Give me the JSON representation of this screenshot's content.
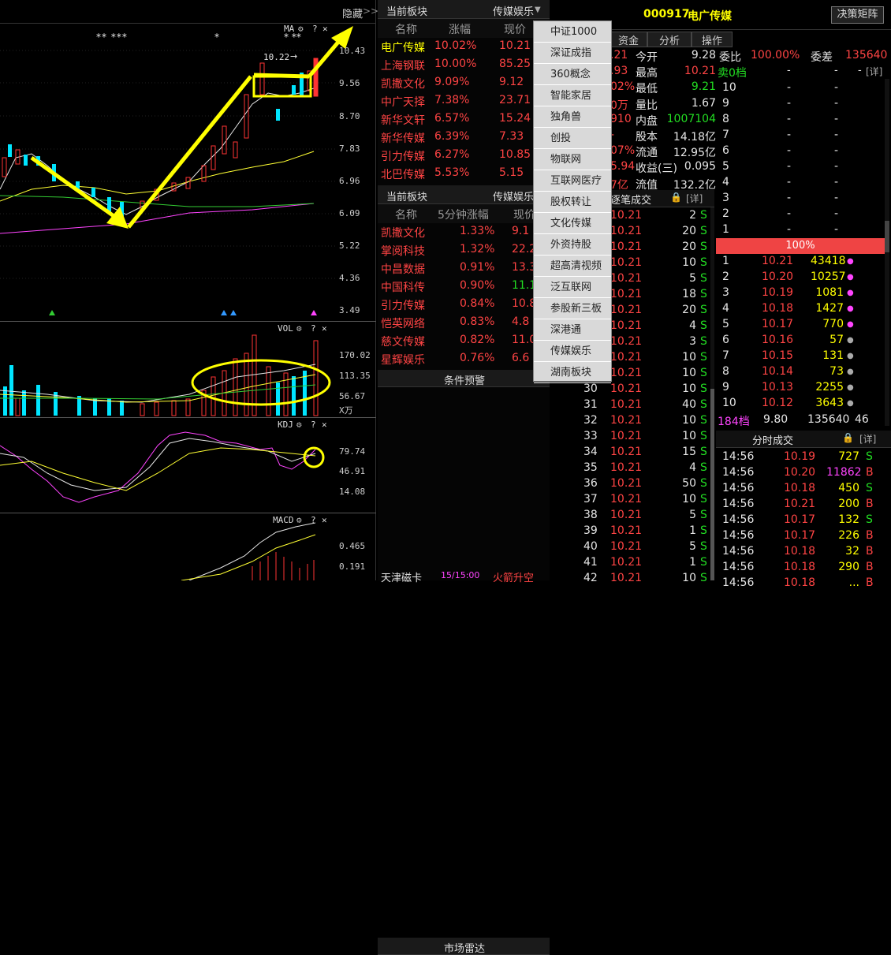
{
  "chart": {
    "header_label": "隐藏",
    "header_chevron": ">>",
    "ma_title": "MA",
    "vol_title": "VOL",
    "kdj_title": "KDJ",
    "macd_title": "MACD",
    "price_axis": [
      "10.43",
      "9.56",
      "8.70",
      "7.83",
      "6.96",
      "6.09",
      "5.22",
      "4.36",
      "3.49"
    ],
    "vol_axis": [
      "170.02",
      "113.35",
      "56.67",
      "X万"
    ],
    "kdj_axis": [
      "79.74",
      "46.91",
      "14.08"
    ],
    "macd_axis": [
      "0.465",
      "0.191"
    ],
    "high_label": "10.22",
    "stars": [
      "** ***",
      "*",
      "* **"
    ]
  },
  "plates1": {
    "title": "当前板块",
    "selector": "传媒娱乐",
    "cols": [
      "名称",
      "涨幅",
      "现价"
    ],
    "rows": [
      {
        "name": "电广传媒",
        "chg": "10.02%",
        "price": "10.21"
      },
      {
        "name": "上海钢联",
        "chg": "10.00%",
        "price": "85.25"
      },
      {
        "name": "凯撒文化",
        "chg": "9.09%",
        "price": "9.12"
      },
      {
        "name": "中广天择",
        "chg": "7.38%",
        "price": "23.71"
      },
      {
        "name": "新华文轩",
        "chg": "6.57%",
        "price": "15.24"
      },
      {
        "name": "新华传媒",
        "chg": "6.39%",
        "price": "7.33"
      },
      {
        "name": "引力传媒",
        "chg": "6.27%",
        "price": "10.85"
      },
      {
        "name": "北巴传媒",
        "chg": "5.53%",
        "price": "5.15"
      }
    ]
  },
  "plates2": {
    "title": "当前板块",
    "selector": "传媒娱乐",
    "cols": [
      "名称",
      "5分钟涨幅",
      "现价"
    ],
    "rows": [
      {
        "name": "凯撒文化",
        "chg": "1.33%",
        "price": "9.1"
      },
      {
        "name": "掌阅科技",
        "chg": "1.32%",
        "price": "22.2"
      },
      {
        "name": "中昌数据",
        "chg": "0.91%",
        "price": "13.3"
      },
      {
        "name": "中国科传",
        "chg": "0.90%",
        "price": "11.1"
      },
      {
        "name": "引力传媒",
        "chg": "0.84%",
        "price": "10.8"
      },
      {
        "name": "恺英网络",
        "chg": "0.83%",
        "price": "4.8"
      },
      {
        "name": "慈文传媒",
        "chg": "0.82%",
        "price": "11.0"
      },
      {
        "name": "星辉娱乐",
        "chg": "0.76%",
        "price": "6.6"
      }
    ]
  },
  "alerts": {
    "title": "条件预警"
  },
  "radar": {
    "title": "市场雷达",
    "row": {
      "name": "天津磁卡",
      "time": "15/15:00",
      "event": "火箭升空"
    }
  },
  "dropdown": [
    "中证1000",
    "深证成指",
    "360概念",
    "智能家居",
    "独角兽",
    "创投",
    "物联网",
    "互联网医疗",
    "股权转让",
    "文化传媒",
    "外资持股",
    "超高清视频",
    "泛互联网",
    "参股新三板",
    "深港通",
    "传媒娱乐",
    "湖南板块"
  ],
  "stock": {
    "code": "000917",
    "name": "电广传媒",
    "decision_btn": "决策矩阵",
    "tabs": [
      "资金",
      "分析",
      "操作"
    ],
    "quote": [
      {
        "v1": ".21",
        "l": "今开",
        "v2": "9.28"
      },
      {
        "v1": ".93",
        "l": "最高",
        "v2": "10.21"
      },
      {
        "v1": "02%",
        "l": "最低",
        "v2": "9.21"
      },
      {
        "v1": "0万",
        "l": "量比",
        "v2": "1.67"
      },
      {
        "v1": "910",
        "l": "内盘",
        "v2": "1007104"
      },
      {
        "v1": "-",
        "l": "股本",
        "v2": "14.18亿"
      },
      {
        "v1": "07%",
        "l": "流通",
        "v2": "12.95亿"
      },
      {
        "v1": "5.94",
        "l": "收益(三)",
        "v2": "0.095"
      },
      {
        "v1": "7亿",
        "l": "流值",
        "v2": "132.2亿"
      }
    ],
    "weibi_label": "委比",
    "weibi": "100.00%",
    "weicha_label": "委差",
    "weicha": "135640",
    "sell0": "卖0档",
    "detail": "[详]",
    "sell_levels": [
      "10",
      "9",
      "8",
      "7",
      "6",
      "5",
      "4",
      "3",
      "2",
      "1"
    ],
    "pct_bar": "100%",
    "buy_levels": [
      {
        "lv": "1",
        "p": "10.21",
        "v": "43418"
      },
      {
        "lv": "2",
        "p": "10.20",
        "v": "10257"
      },
      {
        "lv": "3",
        "p": "10.19",
        "v": "1081"
      },
      {
        "lv": "4",
        "p": "10.18",
        "v": "1427"
      },
      {
        "lv": "5",
        "p": "10.17",
        "v": "770"
      },
      {
        "lv": "6",
        "p": "10.16",
        "v": "57"
      },
      {
        "lv": "7",
        "p": "10.15",
        "v": "131"
      },
      {
        "lv": "8",
        "p": "10.14",
        "v": "73"
      },
      {
        "lv": "9",
        "p": "10.13",
        "v": "2255"
      },
      {
        "lv": "10",
        "p": "10.12",
        "v": "3643"
      }
    ],
    "buy_summary": {
      "a": "184档",
      "b": "9.80",
      "c": "135640",
      "d": "46"
    },
    "ticks_title": "逐笔成交",
    "ticks": [
      {
        "n": "",
        "p": "10.21",
        "v": "2",
        "s": "S"
      },
      {
        "n": "",
        "p": "10.21",
        "v": "20",
        "s": "S"
      },
      {
        "n": "",
        "p": "10.21",
        "v": "20",
        "s": "S"
      },
      {
        "n": "",
        "p": "10.21",
        "v": "10",
        "s": "S"
      },
      {
        "n": "",
        "p": "10.21",
        "v": "5",
        "s": "S"
      },
      {
        "n": "",
        "p": "10.21",
        "v": "18",
        "s": "S"
      },
      {
        "n": "",
        "p": "10.21",
        "v": "20",
        "s": "S"
      },
      {
        "n": "",
        "p": "10.21",
        "v": "4",
        "s": "S"
      },
      {
        "n": "",
        "p": "10.21",
        "v": "3",
        "s": "S"
      },
      {
        "n": "",
        "p": "10.21",
        "v": "10",
        "s": "S"
      },
      {
        "n": "",
        "p": "10.21",
        "v": "10",
        "s": "S"
      },
      {
        "n": "30",
        "p": "10.21",
        "v": "10",
        "s": "S"
      },
      {
        "n": "31",
        "p": "10.21",
        "v": "40",
        "s": "S"
      },
      {
        "n": "32",
        "p": "10.21",
        "v": "10",
        "s": "S"
      },
      {
        "n": "33",
        "p": "10.21",
        "v": "10",
        "s": "S"
      },
      {
        "n": "34",
        "p": "10.21",
        "v": "15",
        "s": "S"
      },
      {
        "n": "35",
        "p": "10.21",
        "v": "4",
        "s": "S"
      },
      {
        "n": "36",
        "p": "10.21",
        "v": "50",
        "s": "S"
      },
      {
        "n": "37",
        "p": "10.21",
        "v": "10",
        "s": "S"
      },
      {
        "n": "38",
        "p": "10.21",
        "v": "5",
        "s": "S"
      },
      {
        "n": "39",
        "p": "10.21",
        "v": "1",
        "s": "S"
      },
      {
        "n": "40",
        "p": "10.21",
        "v": "5",
        "s": "S"
      },
      {
        "n": "41",
        "p": "10.21",
        "v": "1",
        "s": "S"
      },
      {
        "n": "42",
        "p": "10.21",
        "v": "10",
        "s": "S"
      }
    ],
    "minute_title": "分时成交",
    "minute": [
      {
        "t": "14:56",
        "p": "10.19",
        "v": "727",
        "s": "S"
      },
      {
        "t": "14:56",
        "p": "10.20",
        "v": "11862",
        "s": "B"
      },
      {
        "t": "14:56",
        "p": "10.18",
        "v": "450",
        "s": "S"
      },
      {
        "t": "14:56",
        "p": "10.21",
        "v": "200",
        "s": "B"
      },
      {
        "t": "14:56",
        "p": "10.17",
        "v": "132",
        "s": "S"
      },
      {
        "t": "14:56",
        "p": "10.17",
        "v": "226",
        "s": "B"
      },
      {
        "t": "14:56",
        "p": "10.18",
        "v": "32",
        "s": "B"
      },
      {
        "t": "14:56",
        "p": "10.18",
        "v": "290",
        "s": "B"
      },
      {
        "t": "14:56",
        "p": "10.18",
        "v": "...",
        "s": "B"
      }
    ]
  }
}
